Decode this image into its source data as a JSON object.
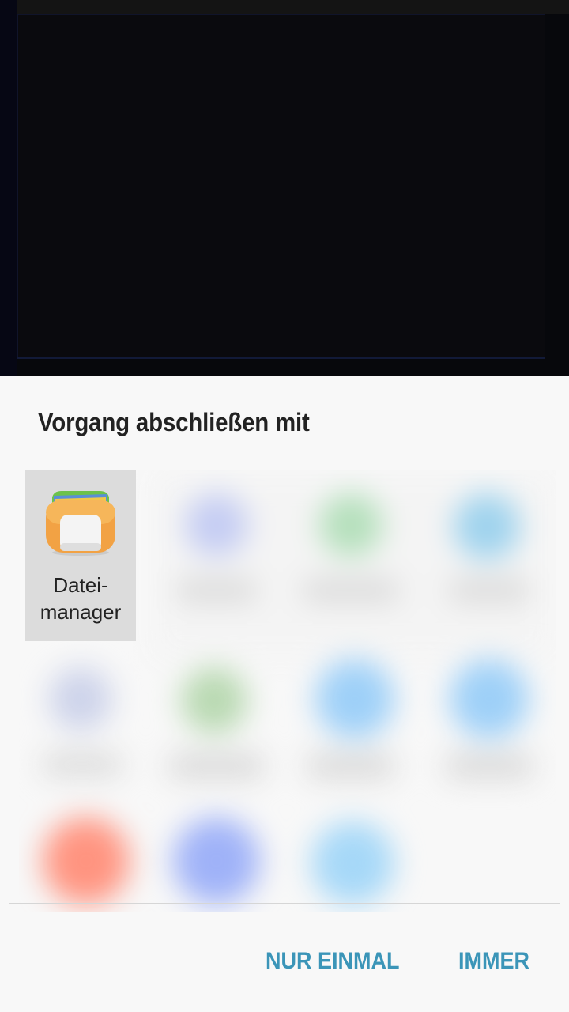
{
  "dialog": {
    "title": "Vorgang abschließen mit",
    "apps": [
      {
        "label": "Datei-\nmanager",
        "icon": "file-manager-icon",
        "selected": true
      }
    ],
    "buttons": {
      "once": "NUR EINMAL",
      "always": "IMMER"
    }
  },
  "colors": {
    "accent": "#3b95b8",
    "sheet_bg": "#f8f8f8",
    "selected_tile": "#dcdcdc"
  }
}
